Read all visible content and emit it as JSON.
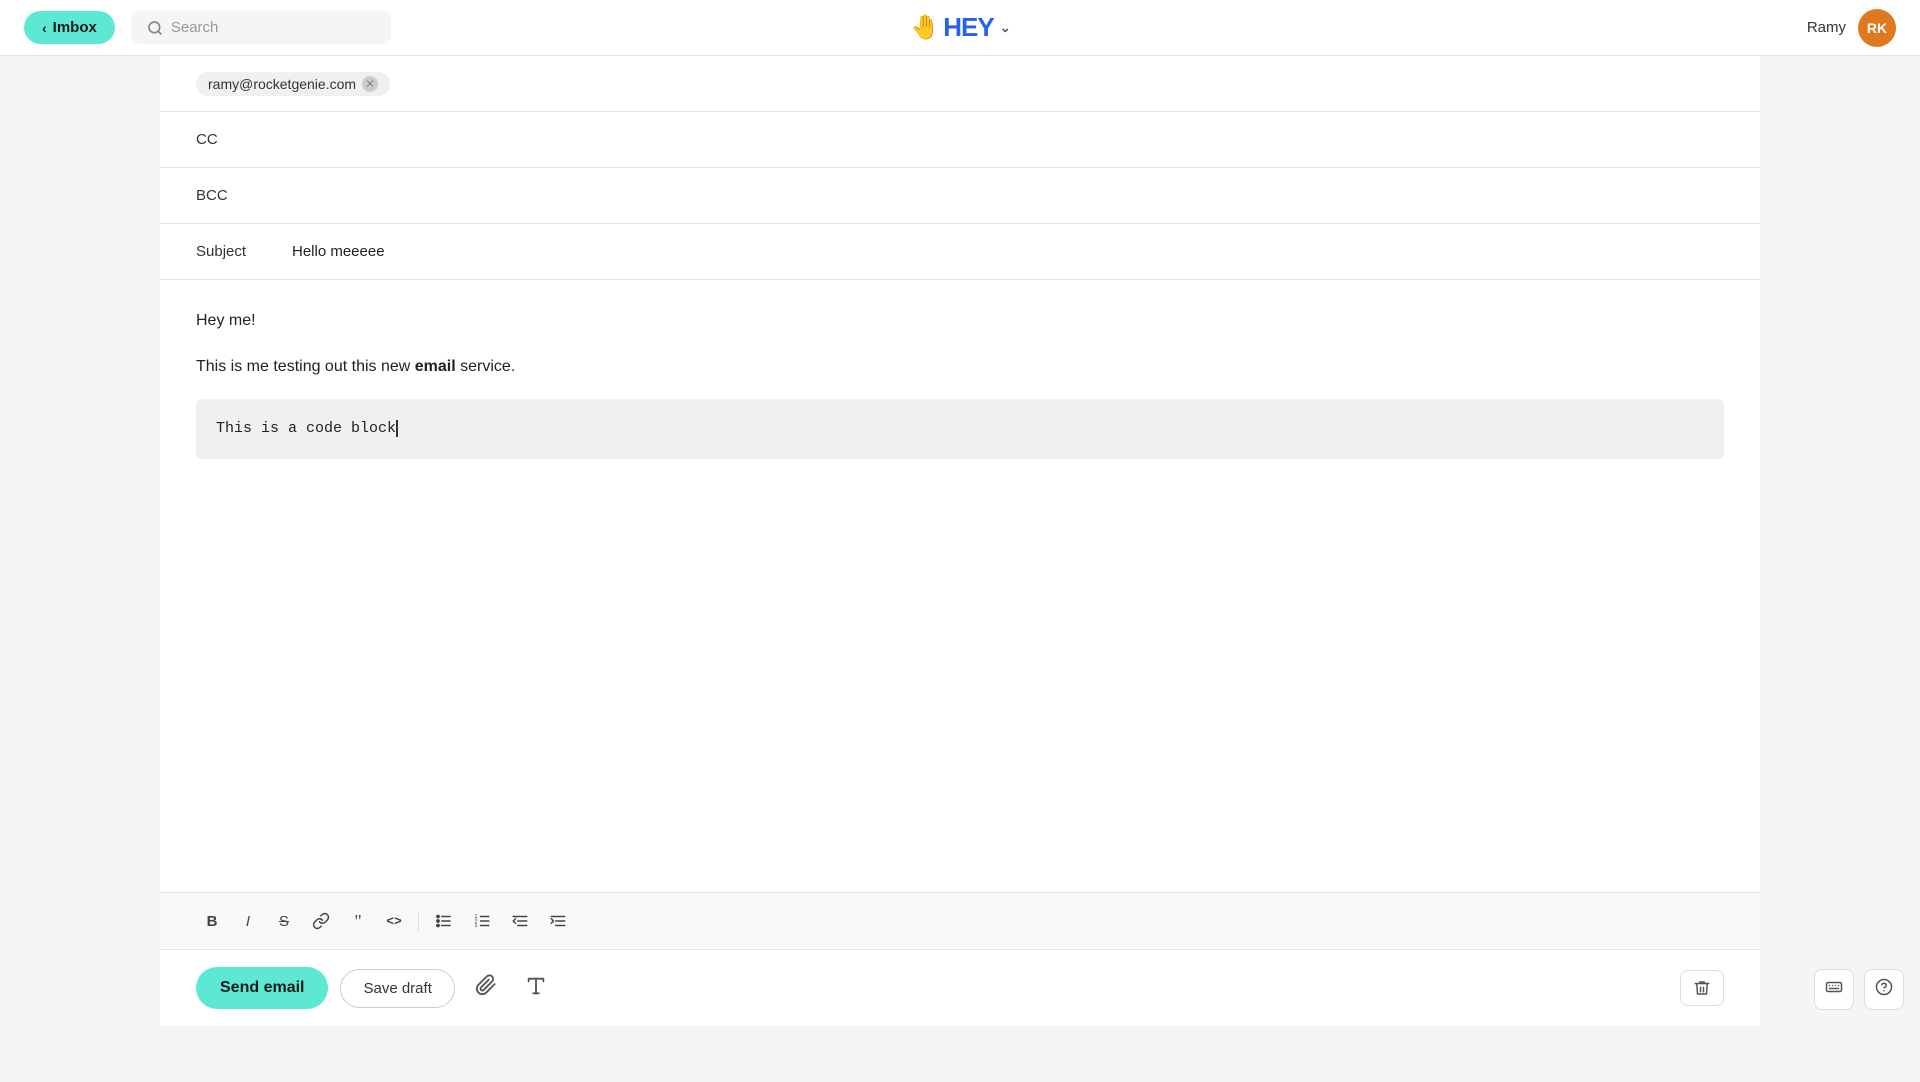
{
  "nav": {
    "inbox_label": "Imbox",
    "search_placeholder": "Search",
    "logo_text": "HEY",
    "user_name": "Ramy",
    "avatar_initials": "RK",
    "avatar_color": "#e07820"
  },
  "compose": {
    "to_email": "ramy@rocketgenie.com",
    "cc_label": "CC",
    "bcc_label": "BCC",
    "subject_label": "Subject",
    "subject_value": "Hello meeeee",
    "body_greeting": "Hey me!",
    "body_text_before_bold": "This is me testing out this new ",
    "body_text_bold": "email",
    "body_text_after_bold": " service.",
    "code_block_text": "This is a code block"
  },
  "toolbar": {
    "bold_label": "B",
    "italic_label": "I",
    "strikethrough_label": "S",
    "link_label": "🔗",
    "quote_label": "❝",
    "code_label": "<>",
    "bullet_list_label": "≡",
    "numbered_list_label": "≡",
    "indent_label": "≡",
    "outdent_label": "≡"
  },
  "actions": {
    "send_label": "Send email",
    "save_draft_label": "Save draft"
  }
}
